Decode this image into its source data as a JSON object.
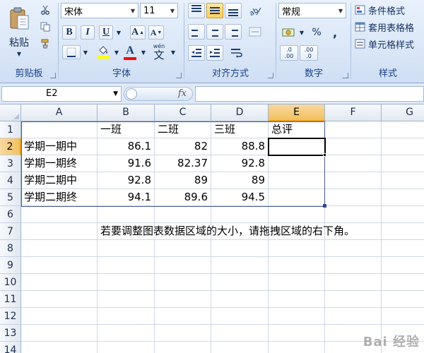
{
  "ribbon": {
    "clipboard": {
      "label": "剪贴板",
      "paste_label": "粘贴",
      "cut_icon": "scissors-icon",
      "copy_icon": "copy-icon",
      "format_painter_icon": "brush-icon"
    },
    "font": {
      "label": "字体",
      "font_name": "宋体",
      "font_size": "11",
      "bold": "B",
      "italic": "I",
      "underline": "U",
      "grow": "A",
      "shrink": "A",
      "font_color_letter": "A",
      "wen_label": "wén",
      "wen_char": "文",
      "fill_color": "#ffff00",
      "font_color": "#ff0000"
    },
    "alignment": {
      "label": "对齐方式"
    },
    "number": {
      "label": "数字",
      "format": "常规",
      "percent": "%",
      "comma": ",",
      "inc_decimal": ".0 .00",
      "dec_decimal": ".00 .0"
    },
    "styles": {
      "label": "样式",
      "conditional": "条件格式",
      "table_format": "套用表格格",
      "cell_styles": "单元格样式"
    }
  },
  "formula_bar": {
    "name_box": "E2",
    "fx": "fx",
    "formula": ""
  },
  "sheet": {
    "columns": [
      "A",
      "B",
      "C",
      "D",
      "E",
      "F",
      "G"
    ],
    "selected_column": "E",
    "selected_row": "2",
    "rows": [
      "1",
      "2",
      "3",
      "4",
      "5",
      "6",
      "7",
      "8",
      "9",
      "10",
      "11",
      "12",
      "13",
      "14"
    ],
    "header_row": [
      "",
      "一班",
      "二班",
      "三班",
      "总评"
    ],
    "data": [
      [
        "学期一期中",
        "86.1",
        "82",
        "88.8",
        ""
      ],
      [
        "学期一期终",
        "91.6",
        "82.37",
        "92.8",
        ""
      ],
      [
        "学期二期中",
        "92.8",
        "89",
        "89",
        ""
      ],
      [
        "学期二期终",
        "94.1",
        "89.6",
        "94.5",
        ""
      ]
    ],
    "note": "若要调整图表数据区域的大小，请拖拽区域的右下角。"
  },
  "watermark": "Bai 经验"
}
